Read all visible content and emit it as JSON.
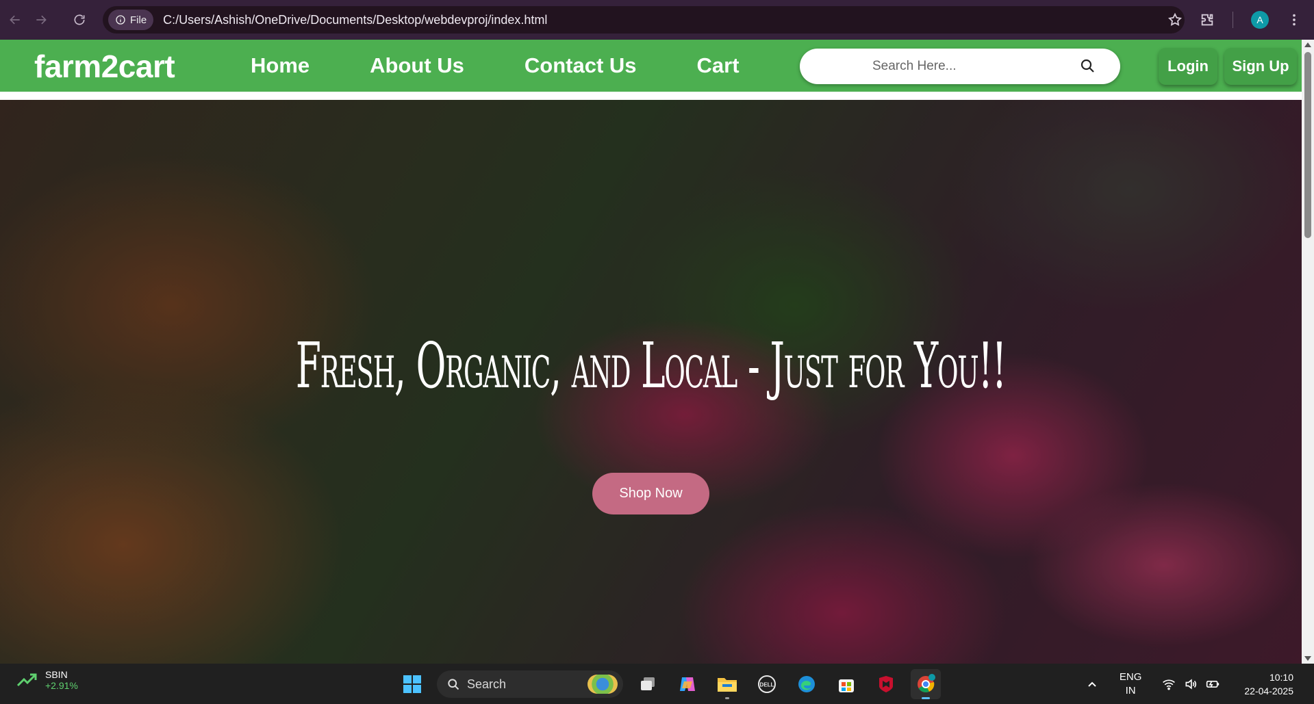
{
  "browser": {
    "scheme_chip": "File",
    "url": "C:/Users/Ashish/OneDrive/Documents/Desktop/webdevproj/index.html",
    "profile_initial": "A"
  },
  "site": {
    "logo": "farm2cart",
    "nav": [
      "Home",
      "About Us",
      "Contact Us",
      "Cart"
    ],
    "search_placeholder": "Search Here...",
    "login": "Login",
    "signup": "Sign Up",
    "hero_title": "Fresh, Organic, and Local - Just for You!!",
    "cta": "Shop Now",
    "colors": {
      "navbar": "#4caf50",
      "auth_button": "#43a047",
      "cta": "#c46a83"
    }
  },
  "taskbar": {
    "stock_symbol": "SBIN",
    "stock_change": "+2.91%",
    "search_label": "Search",
    "lang_top": "ENG",
    "lang_bottom": "IN",
    "time": "10:10",
    "date": "22-04-2025",
    "apps": [
      "windows-start-icon",
      "search-box",
      "task-view-icon",
      "copilot-icon",
      "file-explorer-icon",
      "dell-icon",
      "edge-icon",
      "store-icon",
      "mcafee-icon",
      "chrome-icon"
    ]
  }
}
